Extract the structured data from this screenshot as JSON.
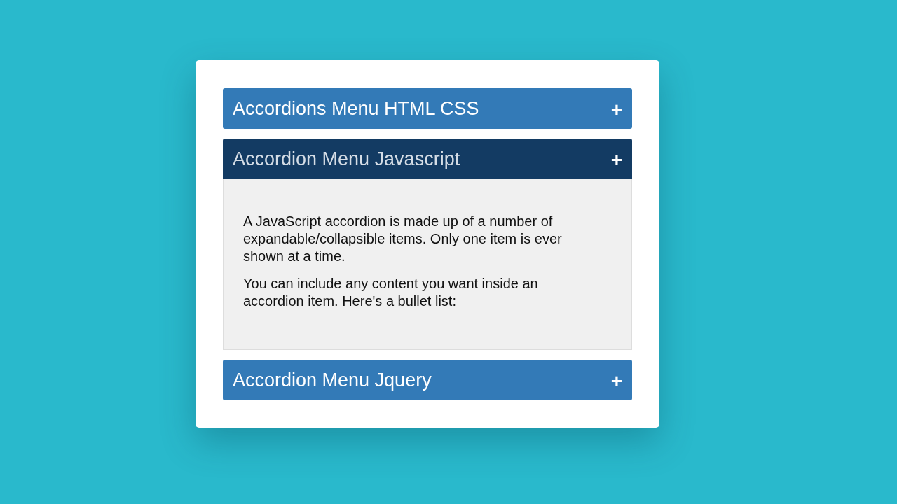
{
  "accordion": {
    "items": [
      {
        "title": "Accordions Menu HTML CSS",
        "icon": "+",
        "expanded": false
      },
      {
        "title": "Accordion Menu Javascript",
        "icon": "+",
        "expanded": true,
        "paragraphs": [
          "A JavaScript accordion is made up of a number of expandable/collapsible items. Only one item is ever shown at a time.",
          "You can include any content you want inside an accordion item. Here's a bullet list:"
        ]
      },
      {
        "title": "Accordion Menu Jquery",
        "icon": "+",
        "expanded": false
      }
    ]
  }
}
